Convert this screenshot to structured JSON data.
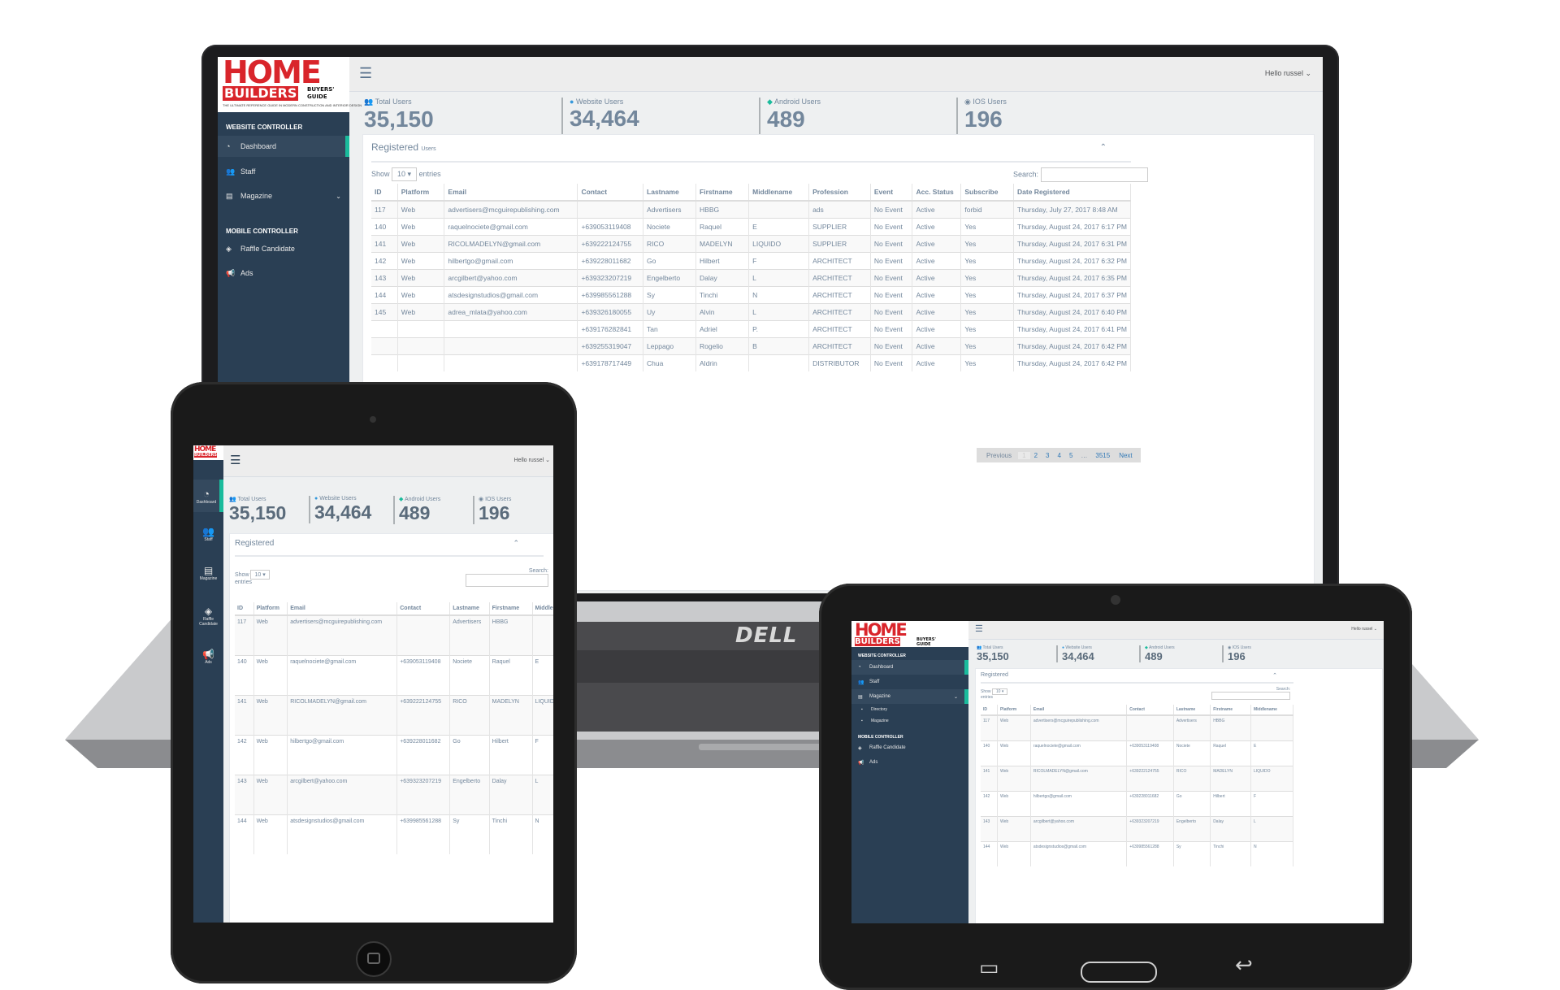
{
  "brand": {
    "line1": "HOME",
    "line2": "BUILDERS",
    "line3": "BUYERS' GUIDE",
    "tagline": "THE ULTIMATE REFERENCE GUIDE IN MODERN CONSTRUCTION AND INTERIOR DESIGN"
  },
  "laptop_brand": "DELL",
  "topbar": {
    "user": "Hello russel"
  },
  "sidebar": {
    "section_web": "WEBSITE CONTROLLER",
    "section_mobile": "MOBILE CONTROLLER",
    "items": [
      {
        "label": "Dashboard",
        "icon": "dashboard-icon"
      },
      {
        "label": "Staff",
        "icon": "users-icon"
      },
      {
        "label": "Magazine",
        "icon": "book-icon"
      },
      {
        "label": "Raffle Candidate",
        "icon": "tag-icon"
      },
      {
        "label": "Ads",
        "icon": "megaphone-icon"
      }
    ],
    "magazine_sub": [
      "Directory",
      "Magazine"
    ],
    "compact_items": [
      "Dashboard",
      "Staff",
      "Magazine",
      "Raffle Candidate",
      "Ads"
    ]
  },
  "stats": [
    {
      "label": "Total Users",
      "value": "35,150"
    },
    {
      "label": "Website Users",
      "value": "34,464"
    },
    {
      "label": "Android Users",
      "value": "489"
    },
    {
      "label": "IOS Users",
      "value": "196"
    }
  ],
  "panel": {
    "title": "Registered",
    "subtitle": "Users",
    "show_label": "Show",
    "entries_value": "10",
    "entries_label": "entries",
    "search_label": "Search:"
  },
  "table": {
    "columns": [
      "ID",
      "Platform",
      "Email",
      "Contact",
      "Lastname",
      "Firstname",
      "Middlename",
      "Profession",
      "Event",
      "Acc. Status",
      "Subscribe",
      "Date Registered"
    ],
    "rows": [
      [
        "117",
        "Web",
        "advertisers@mcguirepublishing.com",
        "",
        "Advertisers",
        "HBBG",
        "",
        "ads",
        "No Event",
        "Active",
        "forbid",
        "Thursday, July 27, 2017 8:48 AM"
      ],
      [
        "140",
        "Web",
        "raquelnociete@gmail.com",
        "+639053119408",
        "Nociete",
        "Raquel",
        "E",
        "SUPPLIER",
        "No Event",
        "Active",
        "Yes",
        "Thursday, August 24, 2017 6:17 PM"
      ],
      [
        "141",
        "Web",
        "RICOLMADELYN@gmail.com",
        "+639222124755",
        "RICO",
        "MADELYN",
        "LIQUIDO",
        "SUPPLIER",
        "No Event",
        "Active",
        "Yes",
        "Thursday, August 24, 2017 6:31 PM"
      ],
      [
        "142",
        "Web",
        "hilbertgo@gmail.com",
        "+639228011682",
        "Go",
        "Hilbert",
        "F",
        "ARCHITECT",
        "No Event",
        "Active",
        "Yes",
        "Thursday, August 24, 2017 6:32 PM"
      ],
      [
        "143",
        "Web",
        "arcgilbert@yahoo.com",
        "+639323207219",
        "Engelberto",
        "Dalay",
        "L",
        "ARCHITECT",
        "No Event",
        "Active",
        "Yes",
        "Thursday, August 24, 2017 6:35 PM"
      ],
      [
        "144",
        "Web",
        "atsdesignstudios@gmail.com",
        "+639985561288",
        "Sy",
        "Tinchi",
        "N",
        "ARCHITECT",
        "No Event",
        "Active",
        "Yes",
        "Thursday, August 24, 2017 6:37 PM"
      ],
      [
        "145",
        "Web",
        "adrea_mlata@yahoo.com",
        "+639326180055",
        "Uy",
        "Alvin",
        "L",
        "ARCHITECT",
        "No Event",
        "Active",
        "Yes",
        "Thursday, August 24, 2017 6:40 PM"
      ],
      [
        "",
        "",
        "",
        "+639176282841",
        "Tan",
        "Adriel",
        "P.",
        "ARCHITECT",
        "No Event",
        "Active",
        "Yes",
        "Thursday, August 24, 2017 6:41 PM"
      ],
      [
        "",
        "",
        "",
        "+639255319047",
        "Leppago",
        "Rogelio",
        "B",
        "ARCHITECT",
        "No Event",
        "Active",
        "Yes",
        "Thursday, August 24, 2017 6:42 PM"
      ],
      [
        "",
        "",
        "",
        "+639178717449",
        "Chua",
        "Aldrin",
        "",
        "DISTRIBUTOR",
        "No Event",
        "Active",
        "Yes",
        "Thursday, August 24, 2017 6:42 PM"
      ]
    ]
  },
  "pagination": {
    "previous": "Previous",
    "pages": [
      "1",
      "2",
      "3",
      "4",
      "5",
      "…",
      "3515"
    ],
    "next": "Next"
  },
  "colors": {
    "sidebar": "#2a3f54",
    "accent": "#1abb9c",
    "brand_red": "#d9252b",
    "text_muted": "#73879c"
  }
}
